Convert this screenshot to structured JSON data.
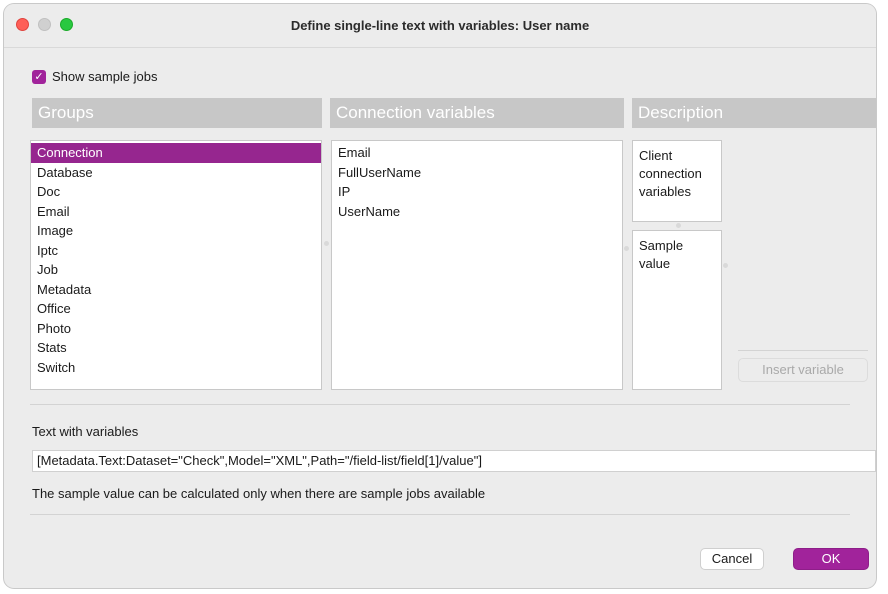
{
  "window": {
    "title": "Define single-line text with variables: User name"
  },
  "options": {
    "show_sample_jobs_label": "Show sample jobs",
    "show_sample_jobs_checked": true
  },
  "groups": {
    "header": "Groups",
    "selected": "Connection",
    "items": [
      "Connection",
      "Database",
      "Doc",
      "Email",
      "Image",
      "Iptc",
      "Job",
      "Metadata",
      "Office",
      "Photo",
      "Stats",
      "Switch"
    ]
  },
  "variables": {
    "header": "Connection variables",
    "items": [
      "Email",
      "FullUserName",
      "IP",
      "UserName"
    ]
  },
  "description": {
    "header": "Description",
    "text": "Client connection variables",
    "sample_value_label": "Sample value"
  },
  "insert_button_label": "Insert variable",
  "text_with_variables": {
    "label": "Text with variables",
    "value": "[Metadata.Text:Dataset=\"Check\",Model=\"XML\",Path=\"/field-list/field[1]/value\"]"
  },
  "info_message": "The sample value can be calculated only when there are sample jobs available",
  "buttons": {
    "cancel": "Cancel",
    "ok": "OK"
  },
  "colors": {
    "accent": "#a1239b",
    "selection": "#96268f",
    "header_bg": "#c7c7c7"
  }
}
